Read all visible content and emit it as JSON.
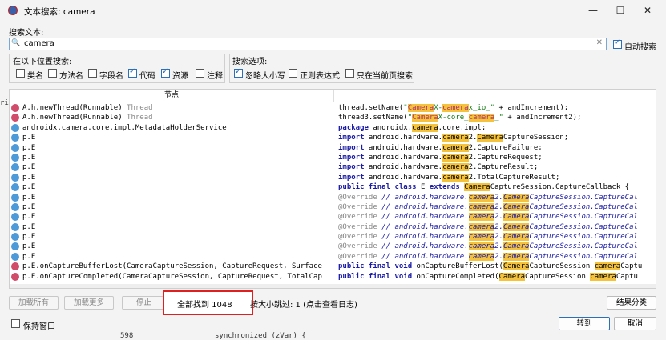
{
  "window": {
    "title": "文本搜索: camera",
    "minimize": "—",
    "maximize": "☐",
    "close": "✕"
  },
  "search": {
    "label": "搜索文本:",
    "value": "camera",
    "auto_search": "自动搜索"
  },
  "location": {
    "label": "在以下位置搜索:",
    "items": [
      {
        "label": "类名",
        "checked": false
      },
      {
        "label": "方法名",
        "checked": false
      },
      {
        "label": "字段名",
        "checked": false
      },
      {
        "label": "代码",
        "checked": true
      },
      {
        "label": "资源",
        "checked": true
      },
      {
        "label": "注释",
        "checked": false
      }
    ]
  },
  "options": {
    "label": "搜索选项:",
    "items": [
      {
        "label": "忽略大小写",
        "checked": true
      },
      {
        "label": "正则表达式",
        "checked": false
      },
      {
        "label": "只在当前页搜索",
        "checked": false
      }
    ]
  },
  "grid": {
    "header_node": "节点"
  },
  "buttons": {
    "load_all": "加载所有",
    "load_more": "加载更多",
    "stop": "停止",
    "group_results": "结果分类",
    "keep_window": "保持窗口",
    "goto": "转到",
    "cancel": "取消"
  },
  "status": {
    "found": "全部找到 1048",
    "skipped": "按大小跳过: 1  (点击查看日志)"
  },
  "background": {
    "left_frag": "ri",
    "line_no": "598",
    "code_frag": "synchronized (zVar) {"
  }
}
